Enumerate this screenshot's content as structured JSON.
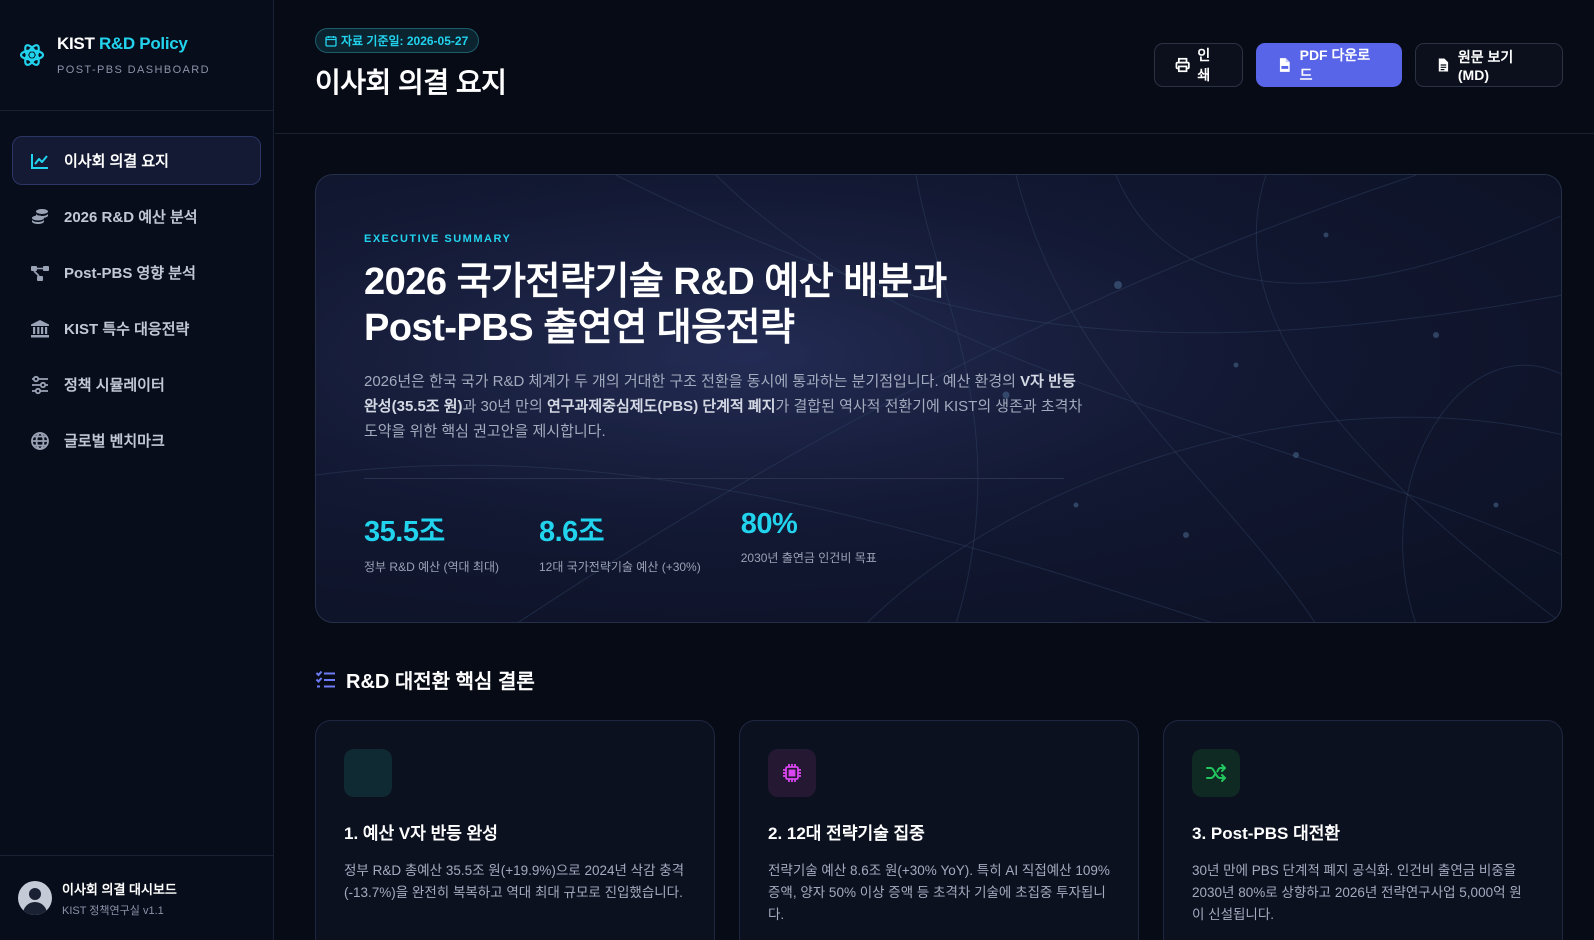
{
  "brand": {
    "title_main": "KIST ",
    "title_accent": "R&D Policy",
    "subtitle": "POST-PBS DASHBOARD",
    "logo_icon": "atom-icon"
  },
  "nav": {
    "items": [
      {
        "label": "이사회 의결 요지",
        "icon": "chart-line-icon",
        "active": true
      },
      {
        "label": "2026 R&D 예산 분석",
        "icon": "coins-icon",
        "active": false
      },
      {
        "label": "Post-PBS 영향 분석",
        "icon": "diagram-icon",
        "active": false
      },
      {
        "label": "KIST 특수 대응전략",
        "icon": "building-columns-icon",
        "active": false
      },
      {
        "label": "정책 시뮬레이터",
        "icon": "sliders-icon",
        "active": false
      },
      {
        "label": "글로벌 벤치마크",
        "icon": "globe-icon",
        "active": false
      }
    ]
  },
  "footer": {
    "title": "이사회 의결 대시보드",
    "subtitle": "KIST 정책연구실 v1.1",
    "icon": "user-circle-icon"
  },
  "header": {
    "date_badge": "자료 기준일: 2026-05-27",
    "page_title": "이사회 의결 요지",
    "buttons": {
      "print": "인쇄",
      "pdf": "PDF 다운로드",
      "md": "원문 보기 (MD)"
    }
  },
  "hero": {
    "eyebrow": "EXECUTIVE SUMMARY",
    "title_line1": "2026 국가전략기술 R&D 예산 배분과",
    "title_line2": "Post-PBS 출연연 대응전략",
    "desc_part1": "2026년은 한국 국가 R&D 체계가 두 개의 거대한 구조 전환을 동시에 통과하는 분기점입니다. 예산 환경의 ",
    "desc_bold1": "V자 반등 완성(35.5조 원)",
    "desc_part2": "과 30년 만의 ",
    "desc_bold2": "연구과제중심제도(PBS) 단계적 폐지",
    "desc_part3": "가 결합된 역사적 전환기에 KIST의 생존과 초격차 도약을 위한 핵심 권고안을 제시합니다.",
    "stats": [
      {
        "value": "35.5조",
        "label": "정부 R&D 예산 (역대 최대)"
      },
      {
        "value": "8.6조",
        "label": "12대 국가전략기술 예산 (+30%)"
      },
      {
        "value": "80%",
        "label": "2030년 출연금 인건비 목표"
      }
    ]
  },
  "section": {
    "title": "R&D 대전환 핵심 결론",
    "icon": "list-check-icon"
  },
  "cards": [
    {
      "title": "1. 예산 V자 반등 완성",
      "body": "정부 R&D 총예산 35.5조 원(+19.9%)으로 2024년 삭감 충격(-13.7%)을 완전히 복복하고 역대 최대 규모로 진입했습니다.",
      "icon": "trend-up-icon"
    },
    {
      "title": "2. 12대 전략기술 집중",
      "body": "전략기술 예산 8.6조 원(+30% YoY). 특히 AI 직접예산 109% 증액, 양자 50% 이상 증액 등 초격차 기술에 초집중 투자됩니다.",
      "icon": "chip-icon"
    },
    {
      "title": "3. Post-PBS 대전환",
      "body": "30년 만에 PBS 단계적 폐지 공식화. 인건비 출연금 비중을 2030년 80%로 상향하고 2026년 전략연구사업 5,000억 원이 신설됩니다.",
      "icon": "shuffle-icon"
    }
  ],
  "colors": {
    "accent": "#22d3ee",
    "primary": "#5865e8",
    "bg": "#070b16"
  }
}
